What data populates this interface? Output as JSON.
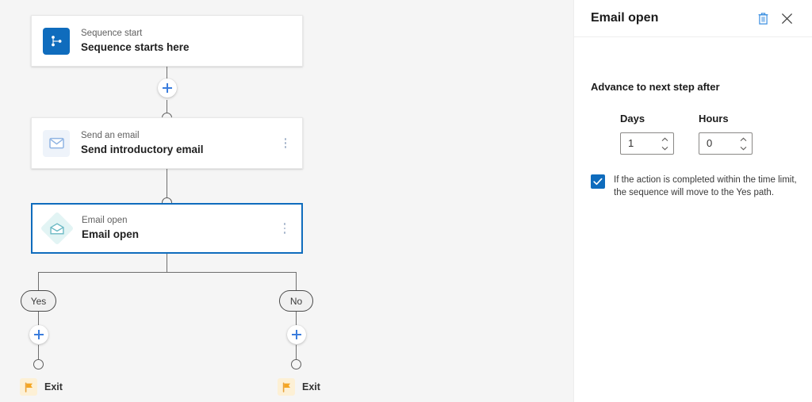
{
  "canvas": {
    "nodes": [
      {
        "id": "sequence-start",
        "subtitle": "Sequence start",
        "title": "Sequence starts here",
        "icon": "sequence-start-icon",
        "selected": false,
        "has_menu": false
      },
      {
        "id": "send-email",
        "subtitle": "Send an email",
        "title": "Send introductory email",
        "icon": "envelope-icon",
        "selected": false,
        "has_menu": true
      },
      {
        "id": "email-open",
        "subtitle": "Email open",
        "title": "Email open",
        "icon": "open-envelope-icon",
        "selected": true,
        "has_menu": true
      }
    ],
    "branches": [
      {
        "id": "yes-branch",
        "label": "Yes",
        "exit_label": "Exit"
      },
      {
        "id": "no-branch",
        "label": "No",
        "exit_label": "Exit"
      }
    ],
    "add_buttons": [
      {
        "id": "add-step-after-start"
      },
      {
        "id": "add-step-yes-branch"
      },
      {
        "id": "add-step-no-branch"
      }
    ],
    "colors": {
      "background": "#f5f5f5",
      "accent": "#0f6cbd",
      "selected_border": "#0f6cbd",
      "connector": "#6e6e6e",
      "plus": "#3b7ddd",
      "flag": "#f5a623",
      "flag_background": "#fdf0d5",
      "start_icon_bg": "#0f6cbd",
      "email_icon_bg": "#eef3fa",
      "open_email_icon_bg": "#e2f4f4"
    }
  },
  "panel": {
    "title": "Email open",
    "delete_icon": "trash-icon",
    "close_icon": "close-icon",
    "section_heading": "Advance to next step after",
    "fields": [
      {
        "id": "days",
        "label": "Days",
        "value": "1"
      },
      {
        "id": "hours",
        "label": "Hours",
        "value": "0"
      }
    ],
    "checkbox": {
      "checked": true,
      "line1": "If the action is completed within the time limit,",
      "line2": "the sequence will move to the Yes path."
    }
  }
}
